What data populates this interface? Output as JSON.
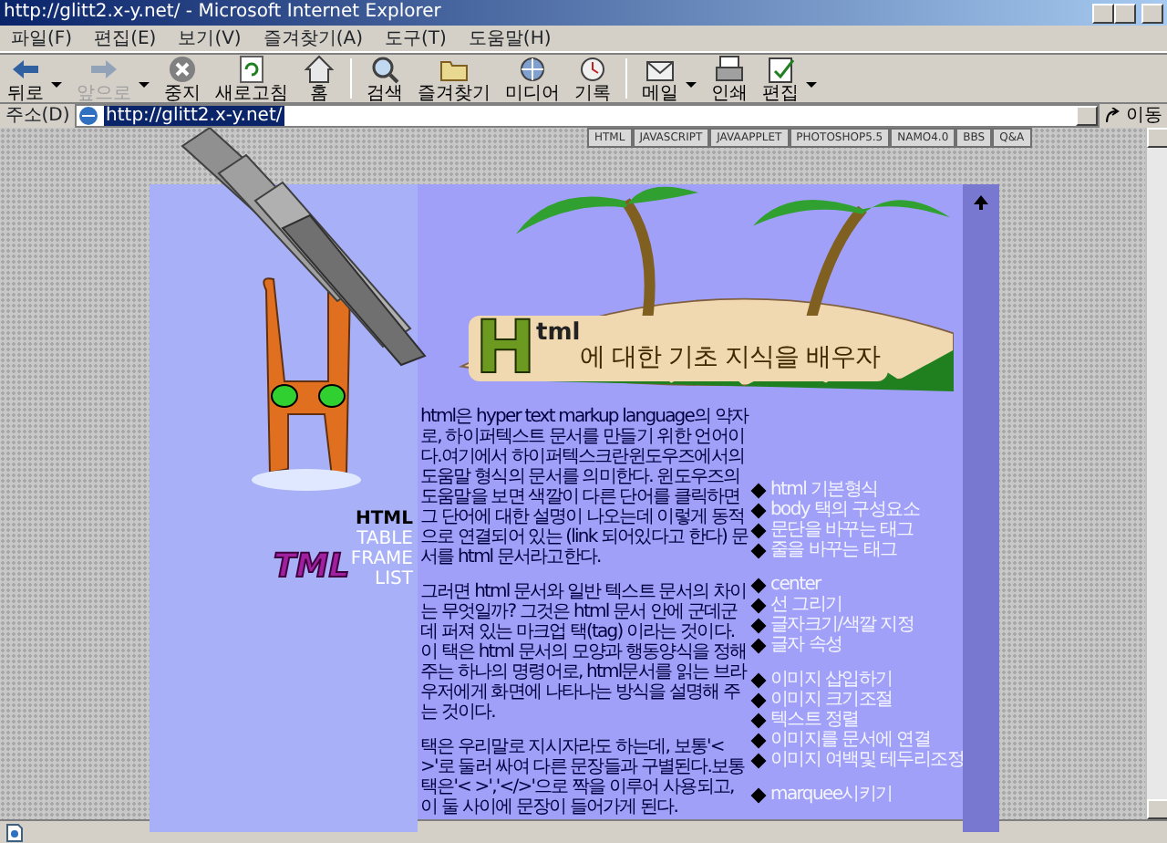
{
  "window": {
    "title": "http://glitt2.x-y.net/ - Microsoft Internet Explorer"
  },
  "menu": [
    "파일(F)",
    "편집(E)",
    "보기(V)",
    "즐겨찾기(A)",
    "도구(T)",
    "도움말(H)"
  ],
  "toolbar": [
    {
      "kind": "back",
      "label": "뒤로",
      "disabled": false,
      "dropdown": true
    },
    {
      "kind": "forward",
      "label": "앞으로",
      "disabled": true,
      "dropdown": true
    },
    {
      "kind": "stop",
      "label": "중지",
      "disabled": false,
      "dropdown": false
    },
    {
      "kind": "refresh",
      "label": "새로고침",
      "disabled": false,
      "dropdown": false
    },
    {
      "kind": "home",
      "label": "홈",
      "disabled": false,
      "dropdown": false
    },
    {
      "kind": "search",
      "label": "검색",
      "disabled": false,
      "dropdown": false
    },
    {
      "kind": "favorites",
      "label": "즐겨찾기",
      "disabled": false,
      "dropdown": false
    },
    {
      "kind": "media",
      "label": "미디어",
      "disabled": false,
      "dropdown": false
    },
    {
      "kind": "history",
      "label": "기록",
      "disabled": false,
      "dropdown": false
    },
    {
      "kind": "mail",
      "label": "메일",
      "disabled": false,
      "dropdown": true
    },
    {
      "kind": "print",
      "label": "인쇄",
      "disabled": false,
      "dropdown": false
    },
    {
      "kind": "edit",
      "label": "편집",
      "disabled": false,
      "dropdown": true
    }
  ],
  "address": {
    "label": "주소(D)",
    "value": "http://glitt2.x-y.net/",
    "go": "이동"
  },
  "site_tabs": [
    "HTML",
    "JAVASCRIPT",
    "JAVAAPPLET",
    "PHOTOSHOP5.5",
    "NAMO4.0",
    "BBS",
    "Q&A"
  ],
  "heading": {
    "initial": "H",
    "raised": "tml",
    "rest": "에 대한 기초 지식을 배우자"
  },
  "logo": {
    "text": "TML"
  },
  "side_nav": [
    {
      "label": "HTML",
      "selected": true
    },
    {
      "label": "TABLE",
      "selected": false
    },
    {
      "label": "FRAME",
      "selected": false
    },
    {
      "label": "LIST",
      "selected": false
    }
  ],
  "paragraphs": [
    "html은 hyper text markup language의 약자로, 하이퍼텍스트 문서를 만들기 위한 언어이다.여기에서 하이퍼텍스크란윈도우즈에서의 도움말 형식의 문서를 의미한다. 윈도우즈의 도움말을 보면 색깔이 다른 단어를 클릭하면 그 단어에 대한 설명이 나오는데 이렇게 동적으로 연결되어 있는 (link 되어있다고 한다) 문서를 html 문서라고한다.",
    "그러면 html 문서와 일반 텍스트 문서의 차이는 무엇일까? 그것은 html 문서 안에 군데군데 퍼져 있는 마크업 택(tag) 이라는 것이다. 이 택은 html 문서의 모양과 행동양식을 정해주는 하나의 명령어로, html문서를 읽는 브라우저에게 화면에 나타나는 방식을 설명해 주는 것이다.",
    "택은 우리말로 지시자라도 하는데, 보통'< >'로 둘러 싸여 다른 문장들과 구별된다.보통 택은'< >','</>'으로 짝을 이루어 사용되고, 이 둘 사이에 문장이 들어가게 된다."
  ],
  "link_groups": [
    [
      "html 기본형식",
      "body 택의 구성요소",
      "문단을 바꾸는 태그",
      "줄을 바꾸는 태그"
    ],
    [
      "center",
      "선 그리기",
      "글자크기/색깔 지정",
      "글자 속성"
    ],
    [
      "이미지 삽입하기",
      "이미지 크기조절",
      "텍스트 정렬",
      "이미지를 문서에 연결",
      "이미지 여백및 테두리조정"
    ],
    [
      "marquee시키기"
    ]
  ]
}
